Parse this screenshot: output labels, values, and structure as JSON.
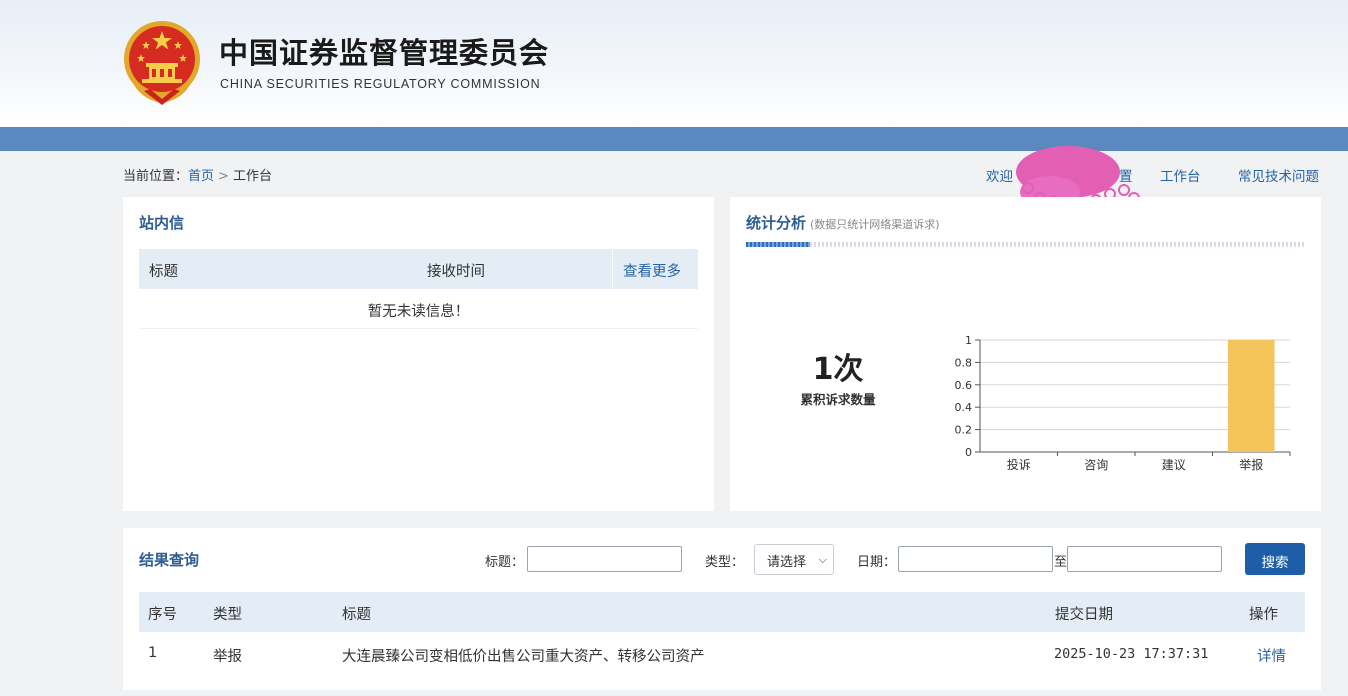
{
  "header": {
    "title": "中国证券监督管理委员会",
    "subtitle": "CHINA SECURITIES REGULATORY COMMISSION",
    "emblem_icon": "national-emblem-icon",
    "bar_color": "#5b89bf"
  },
  "breadcrumb": {
    "prefix": "当前位置：",
    "home": "首页",
    "separator": ">",
    "current": "工作台"
  },
  "topnav": {
    "welcome": "欢迎",
    "settings_fragment": "置",
    "workbench": "工作台",
    "faq": "常见技术问题"
  },
  "messages": {
    "title": "站内信",
    "columns": {
      "title": "标题",
      "received_time": "接收时间"
    },
    "more": "查看更多",
    "empty": "暂无未读信息！"
  },
  "stats": {
    "title": "统计分析",
    "note": "(数据只统计网络渠道诉求)",
    "count_value": "1次",
    "count_label": "累积诉求数量"
  },
  "chart_data": {
    "type": "bar",
    "categories": [
      "投诉",
      "咨询",
      "建议",
      "举报"
    ],
    "values": [
      0,
      0,
      0,
      1
    ],
    "ylim": [
      0,
      1
    ],
    "yticks": [
      "0",
      "0.2",
      "0.4",
      "0.6",
      "0.8",
      "1"
    ],
    "bar_color": "#f3c45a",
    "grid": true
  },
  "results": {
    "title": "结果查询",
    "filters": {
      "title_label": "标题：",
      "title_value": "",
      "type_label": "类型：",
      "type_selected": "请选择",
      "date_label": "日期：",
      "date_from": "",
      "date_to_label": "至",
      "date_to": "",
      "search_button": "搜索"
    },
    "columns": [
      "序号",
      "类型",
      "标题",
      "提交日期",
      "操作"
    ],
    "rows": [
      {
        "index": "1",
        "type": "举报",
        "title": "大连晨臻公司变相低价出售公司重大资产、转移公司资产",
        "date": "2025-10-23 17:37:31",
        "action": "详情"
      }
    ]
  }
}
